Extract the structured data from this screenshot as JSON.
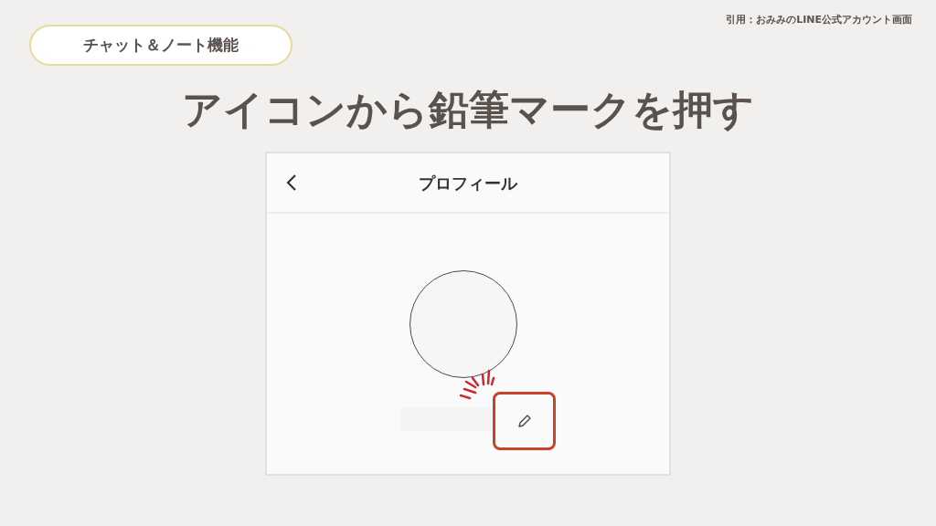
{
  "source_note": "引用：おみみのLINE公式アカウント画面",
  "tag_label": "チャット＆ノート機能",
  "heading": "アイコンから鉛筆マークを押す",
  "profile_screen": {
    "title": "プロフィール",
    "edit_button": {
      "highlighted": true
    }
  }
}
